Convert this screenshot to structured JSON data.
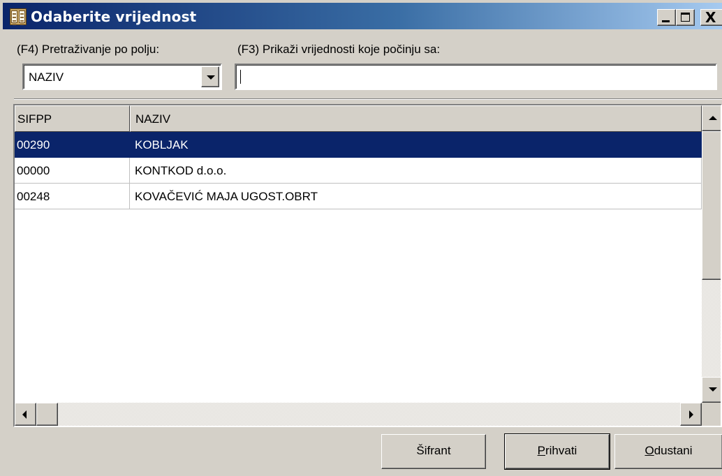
{
  "window": {
    "title": "Odaberite vrijednost",
    "controls": {
      "minimize": "_",
      "maximize": "□",
      "close": "X"
    }
  },
  "filter": {
    "field_label": "(F4) Pretraživanje po polju:",
    "field_value": "NAZIV",
    "search_label": "(F3) Prikaži vrijednosti koje počinju sa:",
    "search_value": ""
  },
  "table": {
    "columns": [
      "SIFPP",
      "NAZIV"
    ],
    "rows": [
      {
        "sifpp": "00290",
        "naziv": "KOBLJAK",
        "selected": true
      },
      {
        "sifpp": "00000",
        "naziv": "KONTKOD d.o.o.",
        "selected": false
      },
      {
        "sifpp": "00248",
        "naziv": "KOVAČEVIĆ MAJA UGOST.OBRT",
        "selected": false
      }
    ]
  },
  "buttons": {
    "sifrant": "Šifrant",
    "prihvati_first": "P",
    "prihvati_rest": "rihvati",
    "odustani_first": "O",
    "odustani_rest": "dustani"
  },
  "colors": {
    "selection": "#0a246a",
    "face": "#d4d0c8"
  }
}
